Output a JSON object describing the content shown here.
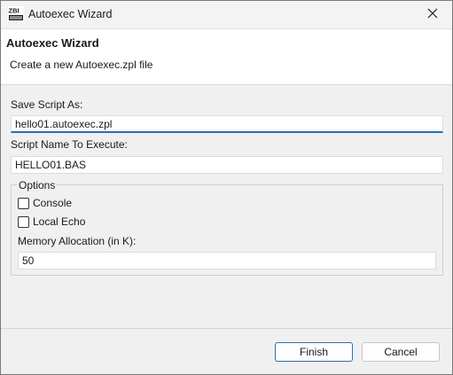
{
  "window": {
    "title": "Autoexec Wizard",
    "app_icon_text": "ZBI"
  },
  "banner": {
    "title": "Autoexec Wizard",
    "description": "Create a new Autoexec.zpl file"
  },
  "form": {
    "save_script_label": "Save Script As:",
    "save_script_value": "hello01.autoexec.zpl",
    "script_name_label": "Script Name To Execute:",
    "script_name_value": "HELLO01.BAS",
    "options_legend": "Options",
    "console_label": "Console",
    "console_checked": false,
    "local_echo_label": "Local Echo",
    "local_echo_checked": false,
    "memory_label": "Memory Allocation (in K):",
    "memory_value": "50"
  },
  "buttons": {
    "finish": "Finish",
    "cancel": "Cancel"
  },
  "colors": {
    "accent": "#2a6db4"
  },
  "icons": {
    "app": "zbi-logo-icon",
    "close": "close-icon"
  }
}
